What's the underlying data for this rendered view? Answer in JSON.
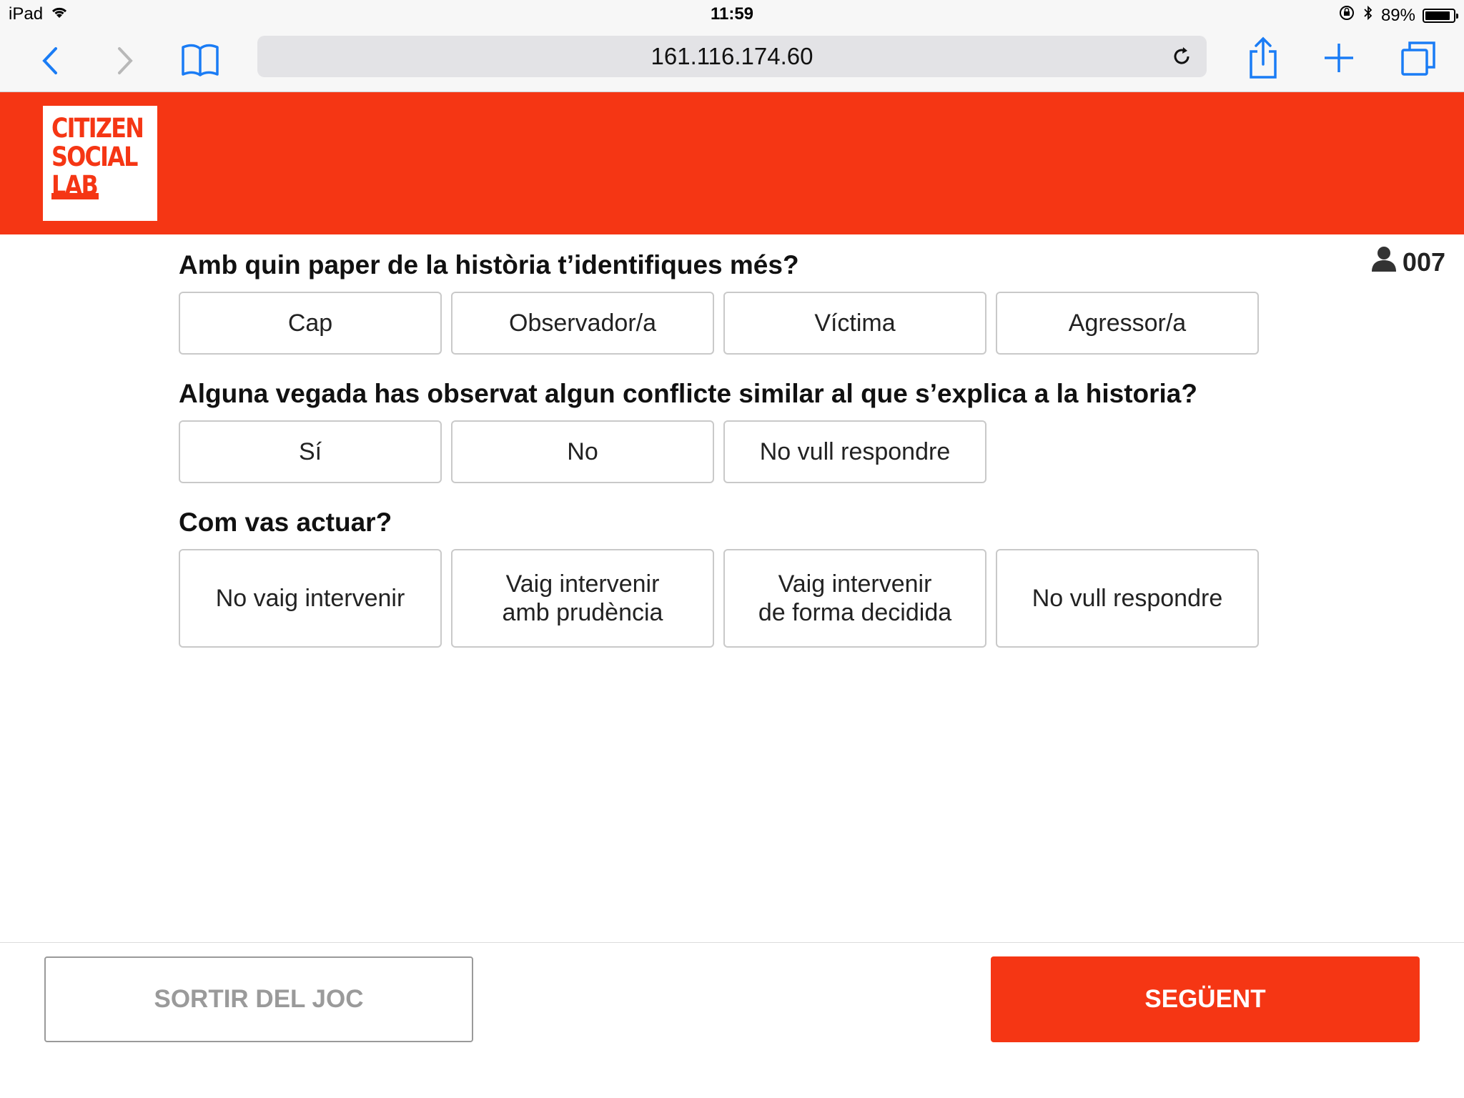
{
  "status_bar": {
    "device": "iPad",
    "time": "11:59",
    "battery": "89%",
    "battery_level": 0.89
  },
  "browser": {
    "url": "161.116.174.60",
    "icons": [
      "back-icon",
      "forward-icon",
      "bookmarks-icon",
      "reload-icon",
      "share-icon",
      "new-tab-icon",
      "tabs-icon"
    ]
  },
  "header": {
    "logo_lines": [
      "CITIZEN",
      "SOCIAL",
      "LAB"
    ],
    "brand_color": "#f53614"
  },
  "user": {
    "id": "007"
  },
  "questions": [
    {
      "text": "Amb quin paper de la història t’identifiques més?",
      "options": [
        "Cap",
        "Observador/a",
        "Víctima",
        "Agressor/a"
      ]
    },
    {
      "text": "Alguna vegada has observat algun conflicte similar al que s’explica a la historia?",
      "options": [
        "Sí",
        "No",
        "No vull respondre"
      ]
    },
    {
      "text": "Com vas actuar?",
      "options": [
        "No vaig intervenir",
        "Vaig intervenir\namb prudència",
        "Vaig intervenir\nde forma decidida",
        "No vull respondre"
      ]
    }
  ],
  "footer": {
    "exit_label": "SORTIR DEL JOC",
    "next_label": "SEGÜENT"
  }
}
